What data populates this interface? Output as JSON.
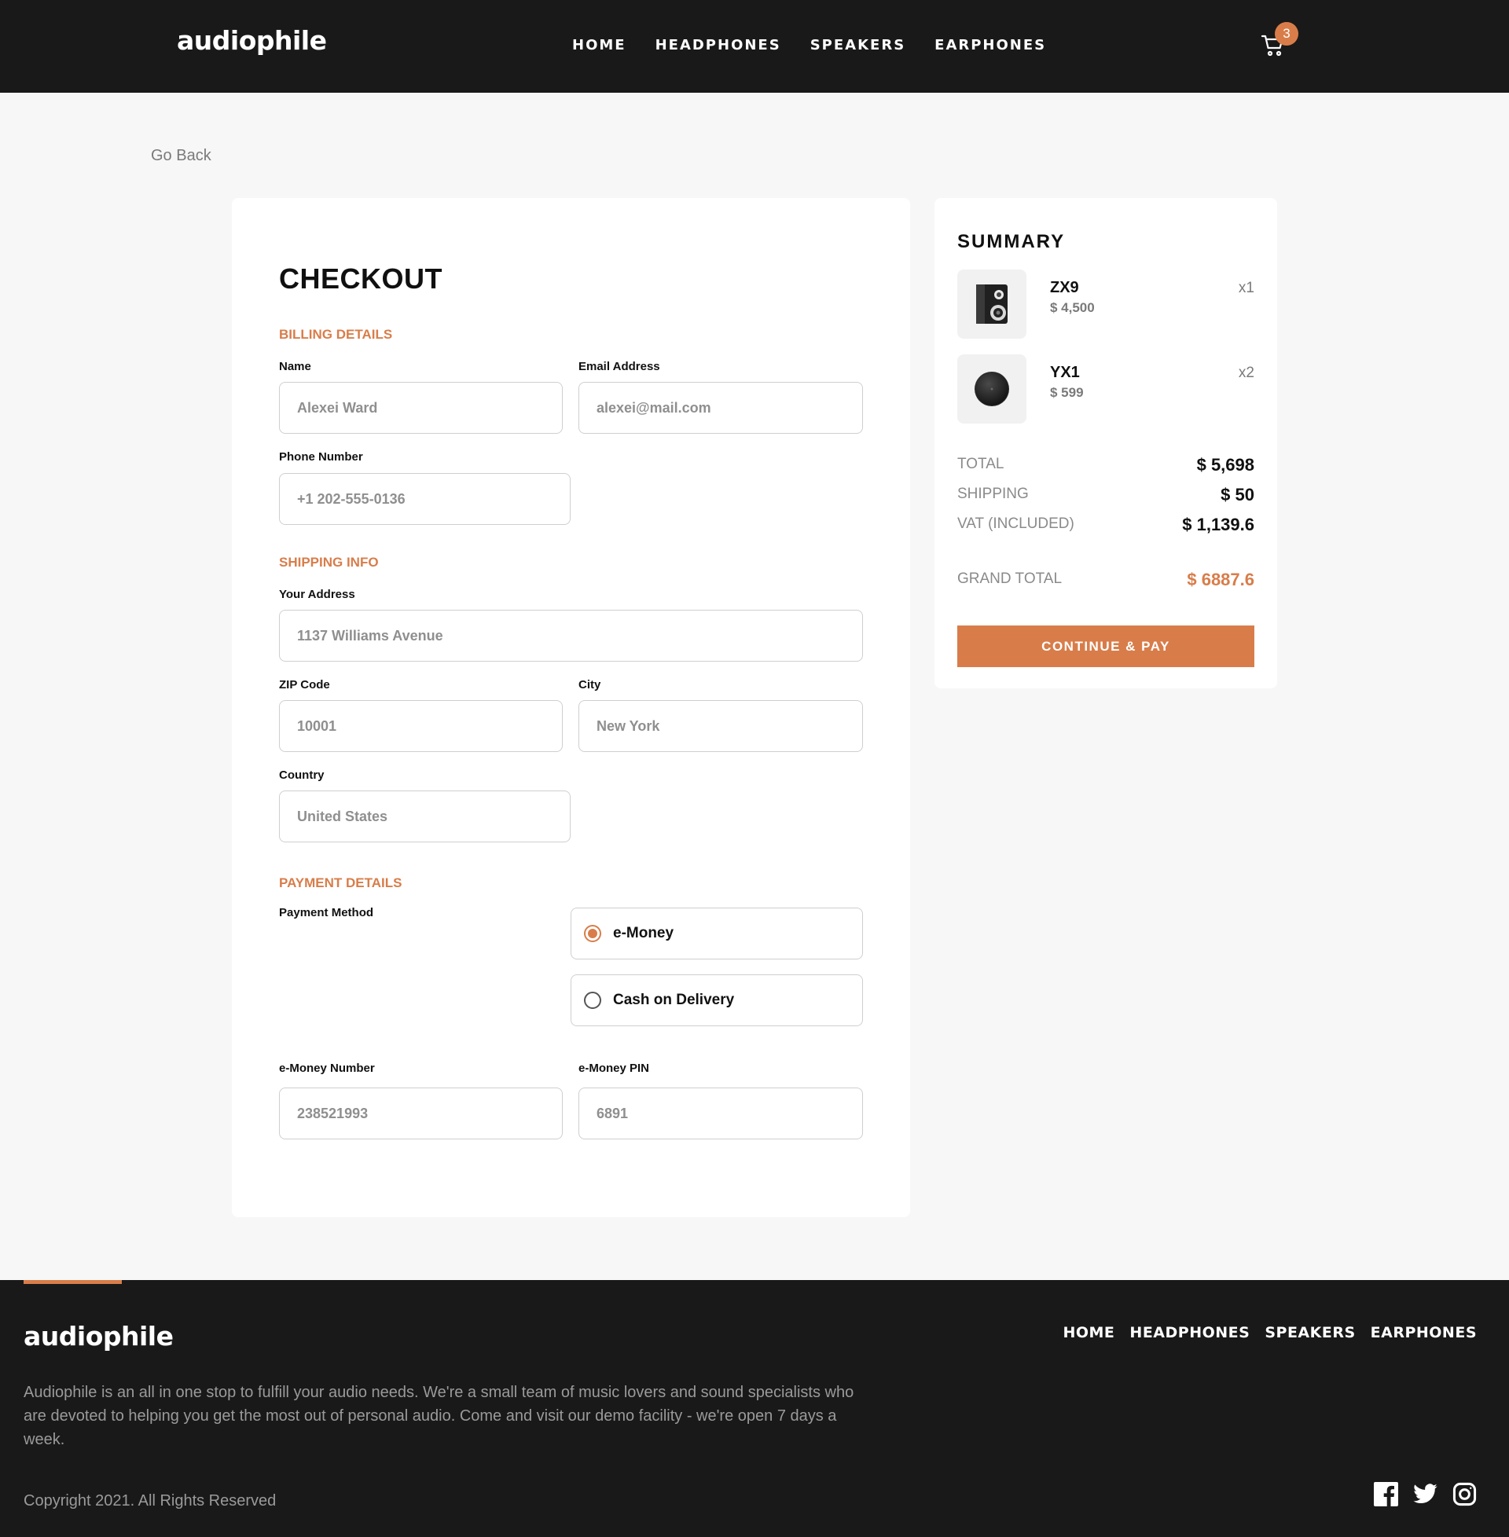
{
  "header": {
    "logo": "audiophile",
    "nav": [
      "HOME",
      "HEADPHONES",
      "SPEAKERS",
      "EARPHONES"
    ],
    "cart_count": "3"
  },
  "go_back": "Go Back",
  "checkout": {
    "title": "CHECKOUT",
    "billing": {
      "section": "BILLING DETAILS",
      "name_label": "Name",
      "name_value": "Alexei Ward",
      "email_label": "Email Address",
      "email_value": "alexei@mail.com",
      "phone_label": "Phone Number",
      "phone_value": "+1 202-555-0136"
    },
    "shipping": {
      "section": "SHIPPING INFO",
      "address_label": "Your Address",
      "address_value": "1137 Williams Avenue",
      "zip_label": "ZIP Code",
      "zip_value": "10001",
      "city_label": "City",
      "city_value": "New York",
      "country_label": "Country",
      "country_value": "United States"
    },
    "payment": {
      "section": "PAYMENT DETAILS",
      "method_label": "Payment Method",
      "options": [
        "e-Money",
        "Cash on Delivery"
      ],
      "selected": "e-Money",
      "number_label": "e-Money Number",
      "number_value": "238521993",
      "pin_label": "e-Money PIN",
      "pin_value": "6891"
    }
  },
  "summary": {
    "title": "SUMMARY",
    "items": [
      {
        "name": "ZX9",
        "price": "$ 4,500",
        "qty": "x1",
        "icon": "speaker-icon"
      },
      {
        "name": "YX1",
        "price": "$ 599",
        "qty": "x2",
        "icon": "earphone-icon"
      }
    ],
    "total_label": "TOTAL",
    "total_value": "$ 5,698",
    "shipping_label": "SHIPPING",
    "shipping_value": "$ 50",
    "vat_label": "VAT (INCLUDED)",
    "vat_value": "$ 1,139.6",
    "grand_label": "GRAND TOTAL",
    "grand_value": "$ 6887.6",
    "pay_button": "CONTINUE & PAY"
  },
  "footer": {
    "logo": "audiophile",
    "nav": [
      "HOME",
      "HEADPHONES",
      "SPEAKERS",
      "EARPHONES"
    ],
    "description": "Audiophile is an all in one stop to fulfill your audio needs. We're a small team of music lovers and sound specialists who are devoted to helping you get the most out of personal audio. Come and visit our demo facility - we're open 7 days a week.",
    "copyright": "Copyright 2021. All Rights Reserved",
    "socials": [
      "facebook-icon",
      "twitter-icon",
      "instagram-icon"
    ]
  },
  "colors": {
    "accent": "#d87d4a",
    "dark": "#191919",
    "background": "#f7f7f7"
  }
}
